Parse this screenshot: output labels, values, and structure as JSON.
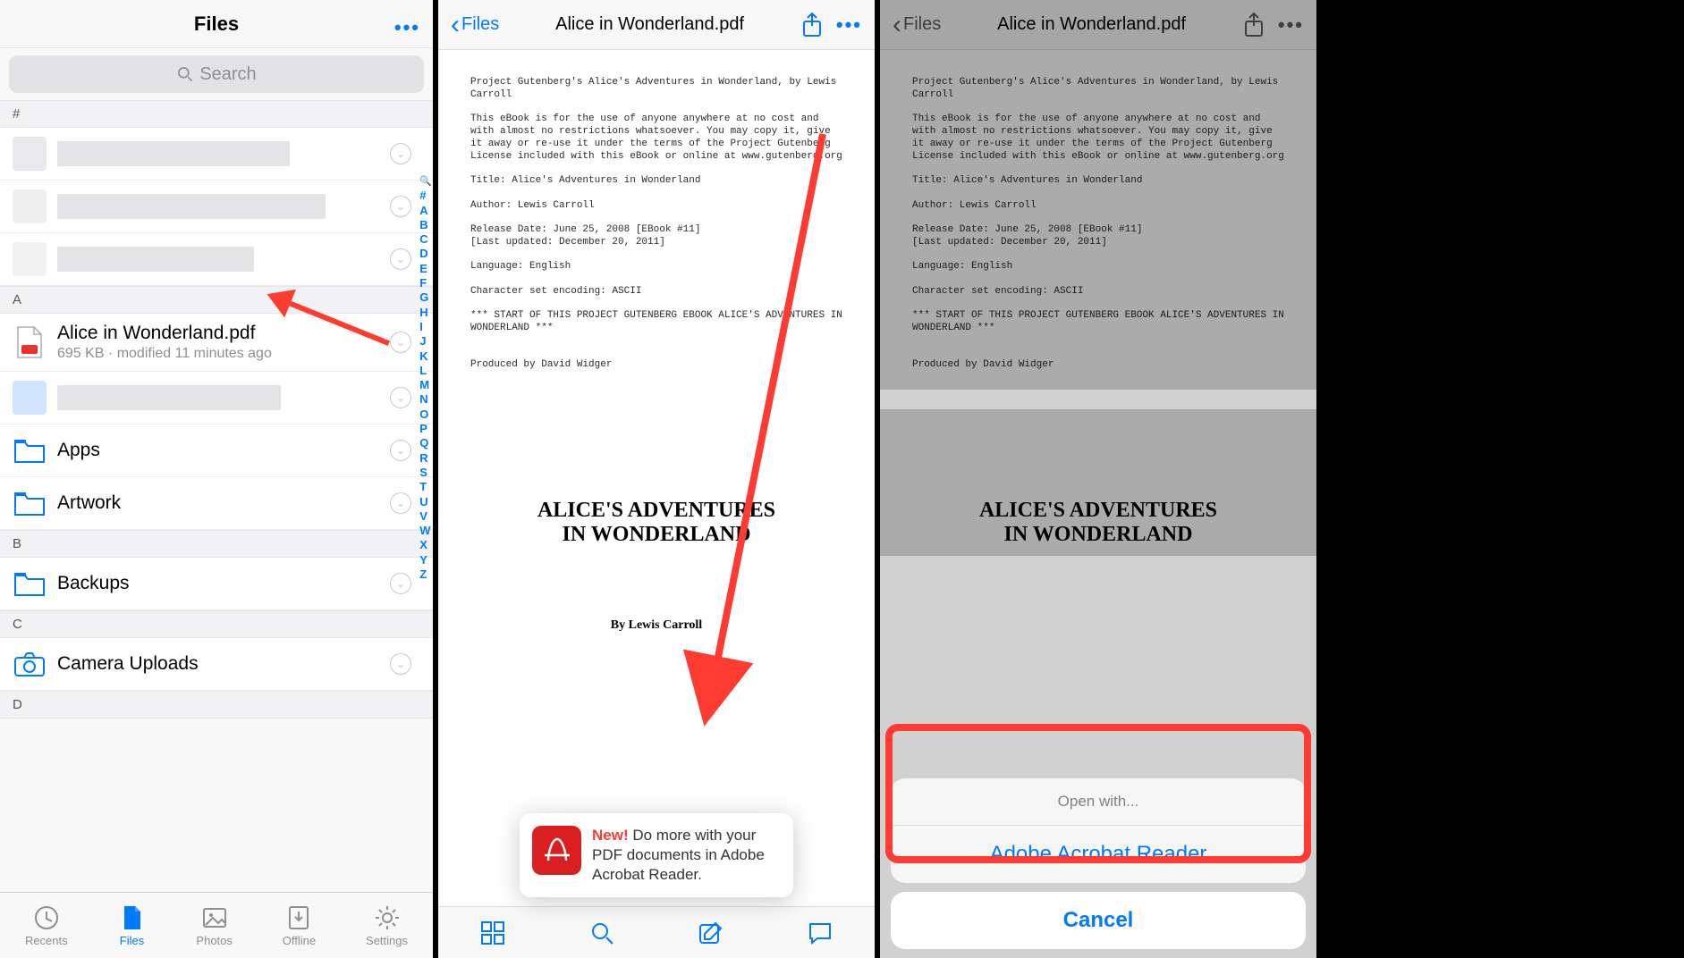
{
  "panel1": {
    "title": "Files",
    "search_placeholder": "Search",
    "sections": {
      "hash": "#",
      "A": "A",
      "B": "B",
      "C": "C",
      "D": "D"
    },
    "file_alice": {
      "name": "Alice in Wonderland.pdf",
      "meta": "695 KB · modified 11 minutes ago"
    },
    "folders": {
      "apps": "Apps",
      "artwork": "Artwork",
      "backups": "Backups",
      "camera": "Camera Uploads"
    },
    "tabs": {
      "recents": "Recents",
      "files": "Files",
      "photos": "Photos",
      "offline": "Offline",
      "settings": "Settings"
    },
    "index": [
      "Q",
      "#",
      "A",
      "B",
      "C",
      "D",
      "E",
      "F",
      "G",
      "H",
      "I",
      "J",
      "K",
      "L",
      "M",
      "N",
      "O",
      "P",
      "Q",
      "R",
      "S",
      "T",
      "U",
      "V",
      "W",
      "X",
      "Y",
      "Z"
    ]
  },
  "panel2": {
    "back_label": "Files",
    "doc_title": "Alice in Wonderland.pdf",
    "pdf_text": "Project Gutenberg's Alice's Adventures in Wonderland, by Lewis Carroll\n\nThis eBook is for the use of anyone anywhere at no cost and with almost no restrictions whatsoever. You may copy it, give it away or re-use it under the terms of the Project Gutenberg License included with this eBook or online at www.gutenberg.org\n\nTitle: Alice's Adventures in Wonderland\n\nAuthor: Lewis Carroll\n\nRelease Date: June 25, 2008 [EBook #11]\n[Last updated: December 20, 2011]\n\nLanguage: English\n\nCharacter set encoding: ASCII\n\n*** START OF THIS PROJECT GUTENBERG EBOOK ALICE'S ADVENTURES IN WONDERLAND ***\n\n\nProduced by David Widger",
    "pdf_h1a": "ALICE'S ADVENTURES",
    "pdf_h1b": "IN WONDERLAND",
    "pdf_by": "By Lewis Carroll",
    "tooltip_new": "New!",
    "tooltip_text": " Do more with your PDF documents in Adobe Acrobat Reader."
  },
  "panel3": {
    "sheet_title": "Open with...",
    "sheet_option": "Adobe Acrobat Reader",
    "sheet_cancel": "Cancel"
  }
}
